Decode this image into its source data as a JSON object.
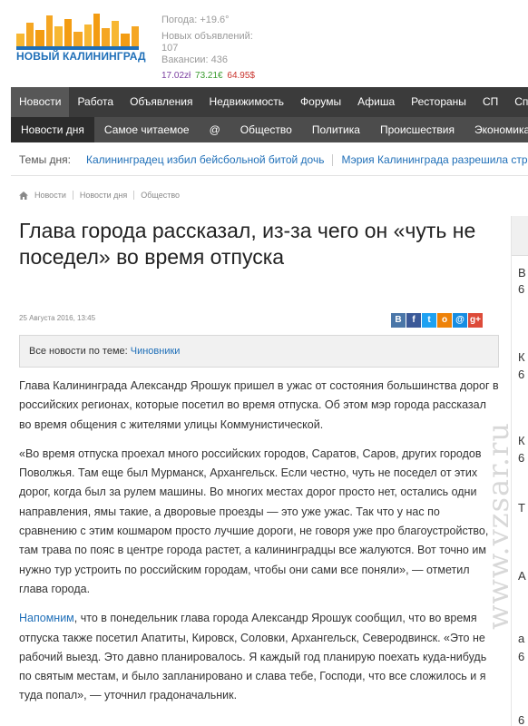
{
  "header": {
    "logo_text": "НОВЫЙ КАЛИНИНГРАД",
    "weather": "Погода: +19.6°",
    "new_ads_label": "Новых объявлений:",
    "new_ads_count": "107",
    "vacancies": "Вакансии: 436",
    "rates": {
      "zl": "17.02zł",
      "eur": "73.21€",
      "usd": "64.95$"
    },
    "colors": {
      "brand_orange": "#f5a623",
      "brand_blue": "#1f6fb8",
      "zl": "#7b3fa0",
      "eur": "#3a9b2f",
      "usd": "#c8312a"
    }
  },
  "nav_main": [
    {
      "label": "Новости",
      "active": true
    },
    {
      "label": "Работа"
    },
    {
      "label": "Объявления"
    },
    {
      "label": "Недвижимость"
    },
    {
      "label": "Форумы"
    },
    {
      "label": "Афиша"
    },
    {
      "label": "Рестораны"
    },
    {
      "label": "СП"
    },
    {
      "label": "Спр"
    }
  ],
  "nav_sub": [
    {
      "label": "Новости дня",
      "active": true
    },
    {
      "label": "Самое читаемое"
    },
    {
      "label": "@"
    },
    {
      "label": "Общество"
    },
    {
      "label": "Политика"
    },
    {
      "label": "Происшествия"
    },
    {
      "label": "Экономика"
    }
  ],
  "topics": {
    "label": "Темы дня:",
    "items": [
      "Калининградец избил бейсбольной битой дочь",
      "Мэрия Калининграда разрешила стро"
    ]
  },
  "breadcrumb": [
    "Новости",
    "Новости дня",
    "Общество"
  ],
  "article": {
    "title": "Глава города рассказал, из-за чего он «чуть не поседел» во время отпуска",
    "date": "25 Августа 2016, 13:45",
    "tag_label": "Все новости по теме:",
    "tag_link": "Чиновники",
    "p1": "Глава Калининграда Александр Ярошук пришел в ужас от состояния большинства дорог в российских регионах, которые посетил во время отпуска. Об этом мэр города рассказал во время общения с жителями улицы Коммунистической.",
    "p2": "«Во время отпуска проехал много российских городов, Саратов, Саров, других городов Поволжья. Там еще был Мурманск, Архангельск. Если честно, чуть не поседел от этих дорог, когда был за рулем машины. Во многих местах дорог просто нет, остались одни направления, ямы такие, а дворовые проезды — это уже ужас. Так что у нас по сравнению с этим кошмаром просто лучшие дороги, не говоря уже про благоустройство, там трава по пояс в центре города растет, а калининградцы все жалуются. Вот точно им нужно тур устроить по российским городам, чтобы они сами все поняли», — отметил глава города.",
    "p3_link": "Напомним",
    "p3": ", что в понедельник глава города Александр Ярошук сообщил, что во время отпуска также посетил Апатиты, Кировск, Соловки, Архангельск, Северодвинск. «Это не рабочий выезд. Это давно планировалось. Я каждый год планирую поехать куда-нибудь по святым местам, и было запланировано и слава тебе, Господи, что все сложилось и я туда попал», — уточнил градоначальник."
  },
  "share_icons": [
    "vk-icon",
    "facebook-icon",
    "twitter-icon",
    "odnoklassniki-icon",
    "mail-icon",
    "google-plus-icon"
  ],
  "right_column": {
    "letters": [
      "В",
      "6",
      "К",
      "6",
      "К",
      "6",
      "Т",
      "А",
      "а",
      "6",
      "6"
    ]
  },
  "watermark": "www.vzsar.ru"
}
